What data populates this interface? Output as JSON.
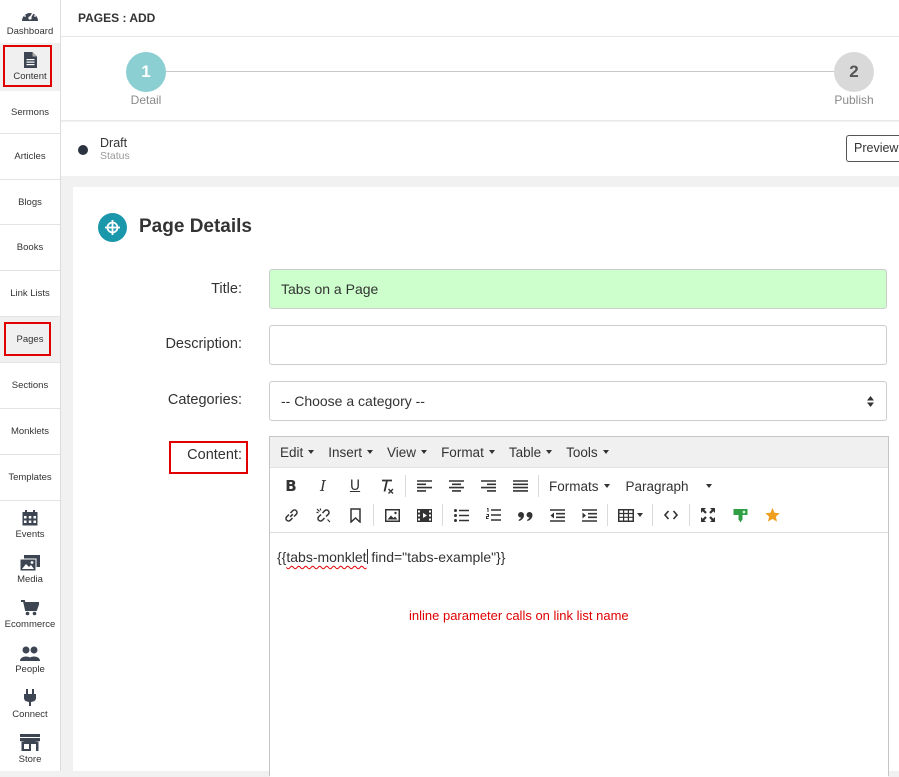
{
  "sidebar": {
    "items": [
      {
        "label": "Dashboard",
        "icon": "dashboard-icon"
      },
      {
        "label": "Content",
        "icon": "document-icon"
      },
      {
        "label": "Sermons"
      },
      {
        "label": "Articles"
      },
      {
        "label": "Blogs"
      },
      {
        "label": "Books"
      },
      {
        "label": "Link Lists"
      },
      {
        "label": "Pages"
      },
      {
        "label": "Sections"
      },
      {
        "label": "Monklets"
      },
      {
        "label": "Templates"
      },
      {
        "label": "Events",
        "icon": "calendar-icon"
      },
      {
        "label": "Media",
        "icon": "images-icon"
      },
      {
        "label": "Ecommerce",
        "icon": "cart-icon"
      },
      {
        "label": "People",
        "icon": "people-icon"
      },
      {
        "label": "Connect",
        "icon": "plug-icon"
      },
      {
        "label": "Store",
        "icon": "store-icon"
      }
    ]
  },
  "header": {
    "title": "PAGES : ADD"
  },
  "steps": [
    {
      "number": "1",
      "label": "Detail",
      "color": "#8ccfd3"
    },
    {
      "number": "2",
      "label": "Publish",
      "color": "#d9d9d9"
    }
  ],
  "status": {
    "value": "Draft",
    "caption": "Status",
    "preview_label": "Preview"
  },
  "details": {
    "heading": "Page Details",
    "title_label": "Title:",
    "title_value": "Tabs on a Page",
    "description_label": "Description:",
    "description_value": "",
    "categories_label": "Categories:",
    "categories_selected": "-- Choose a category --",
    "content_label": "Content:"
  },
  "editor": {
    "menus": [
      "Edit",
      "Insert",
      "View",
      "Format",
      "Table",
      "Tools"
    ],
    "formats_label": "Formats",
    "paragraph_label": "Paragraph",
    "content_open": "{{",
    "content_squiggle": "tabs-monklet",
    "content_rest": " find=\"tabs-example\"}}",
    "annotation": "inline parameter calls on link list name"
  },
  "colors": {
    "accent": "#1a97ab",
    "title_bg": "#ccffcc",
    "annotation": "#e00000",
    "highlight_box": "#e00000"
  }
}
